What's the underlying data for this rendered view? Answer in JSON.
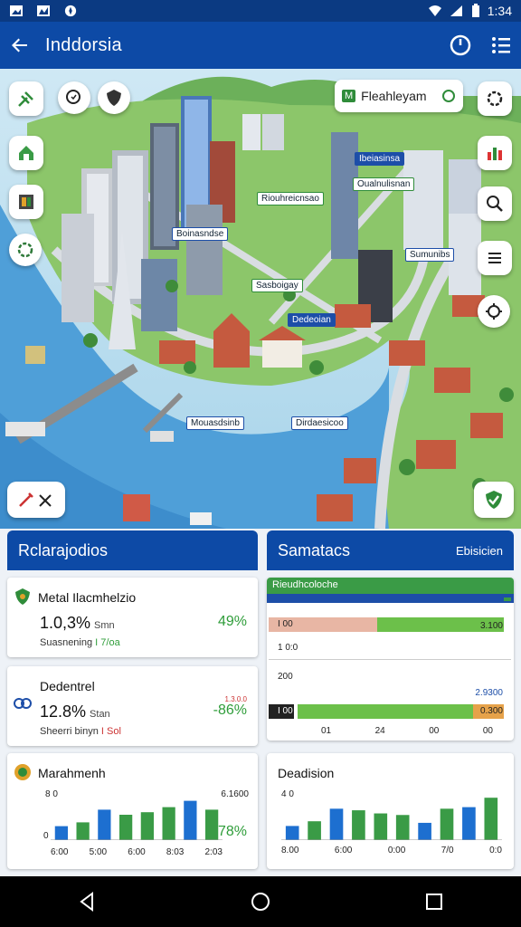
{
  "status": {
    "time": "1:34"
  },
  "appbar": {
    "title": "Inddorsia",
    "back_icon": "arrow-left-icon",
    "refresh_icon": "refresh-icon",
    "menu_icon": "menu-icon"
  },
  "map": {
    "search_chip": {
      "badge": "M",
      "label": "Fleahleyam"
    },
    "labels": [
      {
        "text": "Ibeiasinsa"
      },
      {
        "text": "Boinasndse"
      },
      {
        "text": "Riouhreicnsao"
      },
      {
        "text": "Sasboigay"
      },
      {
        "text": "Sumunibs"
      },
      {
        "text": "Dedeoian"
      },
      {
        "text": "Mouasdsinb"
      },
      {
        "text": "Dirdaesicoo"
      },
      {
        "text": "Oualnulisnan"
      }
    ],
    "colors": {
      "water": "#4f9fd8",
      "land": "#8cc66a",
      "road": "#d9dde2"
    }
  },
  "left_panel": {
    "title": "Rclarajodios",
    "cards": [
      {
        "title": "Metal Ilacmhelzio",
        "value": "1.0,3%",
        "unit": "Smn",
        "note_prefix": "Suasnening",
        "note_value": "I 7/oa",
        "pct": "49%"
      },
      {
        "title": "Dedentrel",
        "value": "12.8%",
        "unit": "Stan",
        "note_prefix": "Sheerri binyn",
        "note_value": "I Sol",
        "pct": "-86%",
        "pct_top": "1.3.0.0"
      },
      {
        "title": "Marahmenh",
        "y_top": "8 0",
        "y_bottom": "0",
        "right_top": "6.1600",
        "pct": "78%",
        "x_labels": [
          "6:00",
          "5:00",
          "6:00",
          "8:03",
          "2:03"
        ]
      }
    ]
  },
  "right_panel": {
    "title": "Samatacs",
    "subtitle": "Ebisicien",
    "bar_card": {
      "title": "Rieudhcoloche",
      "rows": [
        {
          "label": "I 00",
          "right": "3.100"
        },
        {
          "label": "1 0:0",
          "right": ""
        },
        {
          "label": "200",
          "right": "2.9300"
        },
        {
          "label": "I 00",
          "right": "0.300"
        }
      ],
      "x_labels": [
        "01",
        "24",
        "00",
        "00"
      ]
    },
    "line_card": {
      "title": "Deadision",
      "y_top": "4 0",
      "x_labels": [
        "8.00",
        "6:00",
        "0:00",
        "7/0",
        "0:0"
      ]
    }
  },
  "chart_data": [
    {
      "type": "bar",
      "title": "Marahmenh",
      "categories": [
        "6:00",
        "5:00",
        "6:00",
        "8:03",
        "2:03"
      ],
      "series": [
        {
          "name": "",
          "values": [
            22,
            28,
            48,
            40,
            44,
            52,
            62,
            48
          ]
        }
      ],
      "ylim": [
        0,
        80
      ]
    },
    {
      "type": "bar",
      "title": "Deadision",
      "categories": [
        "8.00",
        "6:00",
        "0:00",
        "7/0",
        "0:0"
      ],
      "series": [
        {
          "name": "",
          "values": [
            18,
            24,
            40,
            38,
            34,
            32,
            22,
            40,
            42,
            54
          ]
        }
      ],
      "ylim": [
        0,
        60
      ]
    }
  ]
}
